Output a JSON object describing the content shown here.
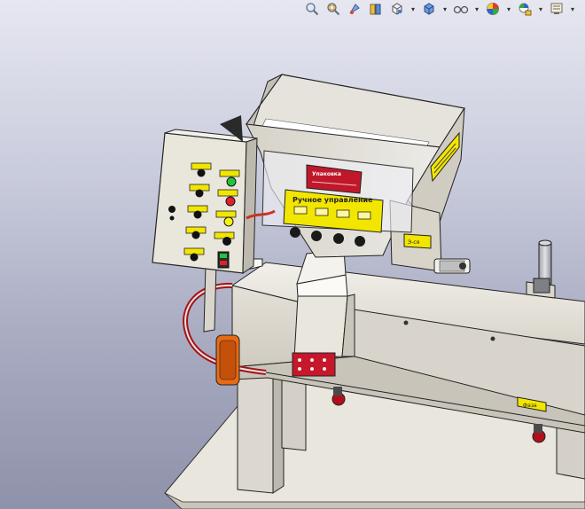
{
  "toolbar": {
    "items": [
      {
        "name": "zoom-to-fit-icon"
      },
      {
        "name": "zoom-to-area-icon"
      },
      {
        "name": "previous-view-icon"
      },
      {
        "name": "section-view-icon"
      },
      {
        "name": "view-orientation-icon",
        "dropdown": true
      },
      {
        "name": "display-style-icon",
        "dropdown": true
      },
      {
        "name": "hide-show-items-icon",
        "dropdown": true
      },
      {
        "name": "edit-appearance-icon",
        "dropdown": true
      },
      {
        "name": "apply-scene-icon",
        "dropdown": true
      },
      {
        "name": "view-settings-icon",
        "dropdown": true
      }
    ]
  },
  "model": {
    "hopper_sign": "Упаковка",
    "front_panel_title": "Ручное управление",
    "small_side_label": "Э-ся",
    "small_front_label": "Вкл",
    "rail_label": "Фаза",
    "colors": {
      "panel_yellow": "#f2e600",
      "sign_red": "#c0182a",
      "light_green": "#21c43a",
      "light_red": "#e0202a",
      "light_yellow": "#f5f20c",
      "machine_gray": "#dedad2",
      "belt_red": "#a5121b"
    }
  }
}
